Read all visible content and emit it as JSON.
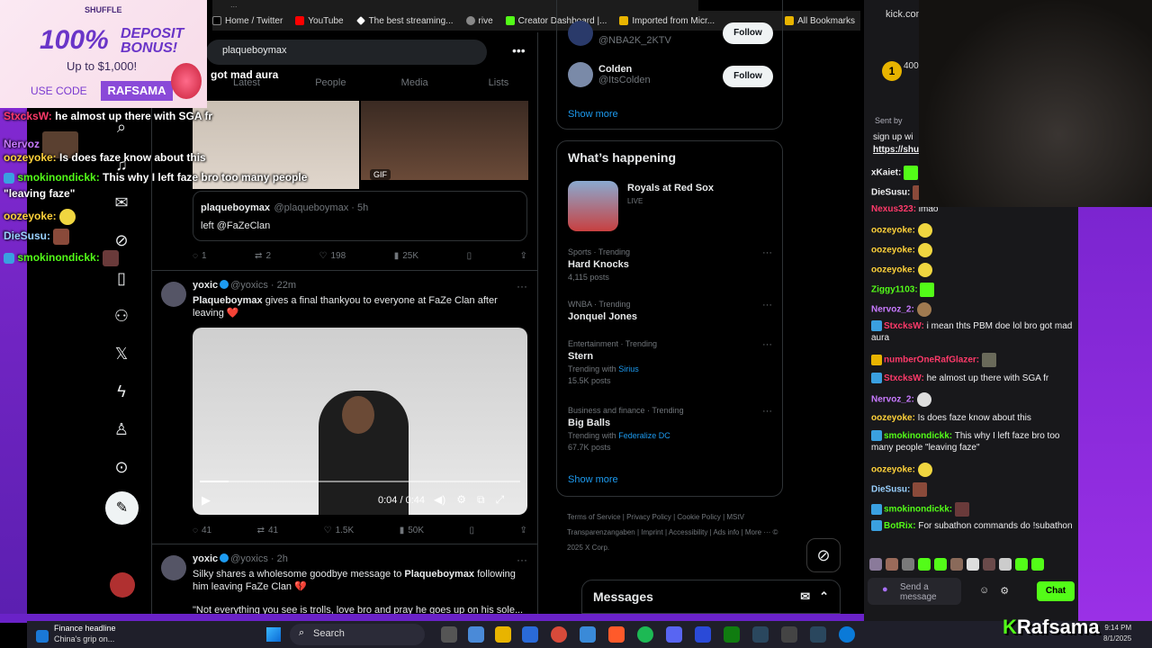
{
  "browser": {
    "url_partial": "...",
    "bookmarks": [
      {
        "label": "Home / Twitter",
        "color": "#000000"
      },
      {
        "label": "YouTube",
        "color": "#ff0000"
      },
      {
        "label": "The best streaming...",
        "color": "#ffffff"
      },
      {
        "label": "rive",
        "color": "#888888"
      },
      {
        "label": "Creator Dashboard |...",
        "color": "#53fc18"
      },
      {
        "label": "Imported from Micr...",
        "color": "#e8b400"
      }
    ],
    "all_bookmarks": "All Bookmarks"
  },
  "x_nav": {
    "icons": [
      "search-icon",
      "bell-icon",
      "mail-icon",
      "grok-icon",
      "bookmark-icon",
      "communities-icon",
      "x-logo-icon",
      "lightning-icon",
      "profile-icon",
      "more-icon"
    ],
    "post_icon": "feather-icon"
  },
  "search": {
    "query": "plaqueboymax",
    "more": "•••"
  },
  "tabs": [
    {
      "label": "Latest",
      "active": false
    },
    {
      "label": "People",
      "active": false
    },
    {
      "label": "Media",
      "active": false
    },
    {
      "label": "Lists",
      "active": false
    }
  ],
  "overlay_text_got_mad_aura": "got mad aura",
  "tweet1": {
    "gif": "GIF",
    "quote": {
      "name": "plaqueboymax",
      "handle": "@plaqueboymax · 5h",
      "text": "left @FaZeClan"
    },
    "replies": "1",
    "retweets": "2",
    "likes": "198",
    "views": "25K"
  },
  "tweet2": {
    "name": "yoxic",
    "handle": "@yoxics · 22m",
    "text_bold": "Plaqueboymax",
    "text": " gives a final thankyou to everyone at FaZe Clan after leaving ❤️",
    "video_time": "0:04 / 0:44",
    "video_progress": 0.09,
    "replies": "41",
    "retweets": "41",
    "likes": "1.5K",
    "views": "50K"
  },
  "tweet3": {
    "name": "yoxic",
    "handle": "@yoxics · 2h",
    "text_a": "Silky shares a wholesome goodbye message to ",
    "text_bold": "Plaqueboymax",
    "text_b": " following him leaving FaZe Clan 💔",
    "text2": "\"Not everything you see is trolls, love bro and pray he goes up on his sole..."
  },
  "who_to_follow": [
    {
      "name": "",
      "handle": "@NBA2K_2KTV",
      "button": "Follow"
    },
    {
      "name": "Colden",
      "handle": "@ItsColden",
      "button": "Follow"
    }
  ],
  "who_show_more": "Show more",
  "happening": {
    "title": "What’s happening",
    "event": {
      "title": "Royals at Red Sox",
      "status": "LIVE"
    },
    "trends": [
      {
        "category": "Sports · Trending",
        "title": "Hard Knocks",
        "with": "",
        "with_link": "",
        "posts": "4,115 posts"
      },
      {
        "category": "WNBA · Trending",
        "title": "Jonquel Jones",
        "with": "",
        "with_link": "",
        "posts": ""
      },
      {
        "category": "Entertainment · Trending",
        "title": "Stern",
        "with": "Trending with ",
        "with_link": "Sirius",
        "posts": "15.5K posts"
      },
      {
        "category": "Business and finance · Trending",
        "title": "Big Balls",
        "with": "Trending with ",
        "with_link": "Federalize DC",
        "posts": "67.7K posts"
      }
    ],
    "show_more": "Show more"
  },
  "footer_links": "Terms of Service  |  Privacy Policy  |  Cookie Policy  |  MStV Transparenzangaben  |  Imprint  |  Accessibility  |  Ads info  |  More ···  © 2025 X Corp.",
  "messages": {
    "label": "Messages"
  },
  "promo": {
    "brand": "SHUFFLE",
    "big": "100%",
    "bonus_line1": "DEPOSIT",
    "bonus_line2": "BONUS!",
    "upto": "Up to $1,000!",
    "code_label": "USE CODE",
    "code": "RAFSAMA"
  },
  "overlay_chat": [
    {
      "user": "StxcksW:",
      "text": " he almost up there with SGA fr",
      "color": "#ff3a6a"
    },
    {
      "user": "Nervoz",
      "text": "",
      "color": "#c87aff"
    },
    {
      "user": "oozeyoke:",
      "text": " Is does faze know about this",
      "color": "#ffd23a"
    },
    {
      "user": "smokinondickk:",
      "text": " This why I left faze bro too many people",
      "color": "#53fc18"
    },
    {
      "user": "",
      "text": "\"leaving faze\"",
      "color": "#ffffff"
    },
    {
      "user": "oozeyoke:",
      "text": "",
      "color": "#ffd23a"
    },
    {
      "user": "DieSusu:",
      "text": "",
      "color": "#9ad1ff"
    },
    {
      "user": "smokinondickk:",
      "text": "",
      "color": "#53fc18"
    }
  ],
  "kick": {
    "url": "kick.com",
    "badge_count": "1",
    "badge_text": "400",
    "sent_by": "Sent by",
    "signup": "sign up wi",
    "signup_link": "https://shu",
    "messages": [
      {
        "user": "xKaiet:",
        "text": "",
        "color": "#ffd23a"
      },
      {
        "user": "DieSusu:",
        "text": "",
        "color": "#9ad1ff"
      },
      {
        "user": "Nexus323:",
        "text": " lmao",
        "color": "#ff6a6a"
      },
      {
        "user": "oozeyoke:",
        "text": "",
        "color": "#ffd23a"
      },
      {
        "user": "oozeyoke:",
        "text": "",
        "color": "#ffd23a"
      },
      {
        "user": "oozeyoke:",
        "text": "",
        "color": "#ffd23a"
      },
      {
        "user": "Ziggy1103:",
        "text": "",
        "color": "#53fc18"
      },
      {
        "user": "Nervoz_2:",
        "text": "",
        "color": "#c87aff"
      },
      {
        "user": "StxcksW:",
        "text": " i mean thts PBM doe lol bro got mad aura",
        "color": "#ff3a6a"
      },
      {
        "user": "numberOneRafGlazer:",
        "text": "",
        "color": "#ff3a6a"
      },
      {
        "user": "StxcksW:",
        "text": " he almost up there with SGA fr",
        "color": "#ff3a6a"
      },
      {
        "user": "Nervoz_2:",
        "text": "",
        "color": "#c87aff"
      },
      {
        "user": "oozeyoke:",
        "text": " Is does faze know about this",
        "color": "#ffd23a"
      },
      {
        "user": "smokinondickk:",
        "text": " This why I left faze bro too many people \"leaving faze\"",
        "color": "#53fc18"
      },
      {
        "user": "oozeyoke:",
        "text": "",
        "color": "#ffd23a"
      },
      {
        "user": "DieSusu:",
        "text": "",
        "color": "#9ad1ff"
      },
      {
        "user": "smokinondickk:",
        "text": "",
        "color": "#53fc18"
      },
      {
        "user": "BotRix:",
        "text": " For subathon commands do !subathon",
        "color": "#53fc18"
      }
    ],
    "input_placeholder": "Send a message",
    "chat_button": "Chat"
  },
  "taskbar": {
    "news_title": "Finance headline",
    "news_sub": "China's grip on...",
    "search": "Search",
    "brand": "Rafsama",
    "brand_k": "K",
    "time": "9:14 PM",
    "date": "8/1/2025"
  }
}
